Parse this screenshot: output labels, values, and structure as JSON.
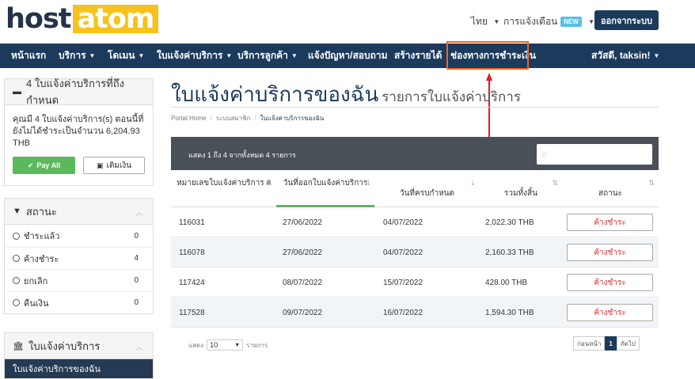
{
  "header": {
    "logo_part1": "host",
    "logo_part2": "atom",
    "language": "ไทย",
    "notifications": "การแจ้งเตือน",
    "new_badge": "NEW",
    "logout": "ออกจากระบบ"
  },
  "nav": {
    "items": [
      {
        "label": "หน้าแรก",
        "caret": false
      },
      {
        "label": "บริการ",
        "caret": true
      },
      {
        "label": "โดเมน",
        "caret": true
      },
      {
        "label": "ใบแจ้งค่าบริการ",
        "caret": true
      },
      {
        "label": "บริการลูกค้า",
        "caret": true
      },
      {
        "label": "แจ้งปัญหา/สอบถาม",
        "caret": false
      },
      {
        "label": "สร้างรายได้",
        "caret": false
      },
      {
        "label": "ช่องทางการชำระเงิน",
        "caret": false
      }
    ],
    "user": "สวัสดี, taksin!"
  },
  "sidebar": {
    "due_panel": {
      "title": "4 ใบแจ้งค่าบริการที่ถึงกำหนด",
      "text": "คุณมี 4 ใบแจ้งค่าบริการ(s) ตอนนี้ที่ยังไม่ได้ชำระเป็นจำนวน 6,204.93 THB",
      "pay_all": "Pay All",
      "add_funds": "เติมเงิน"
    },
    "status_panel": {
      "title": "สถานะ",
      "items": [
        {
          "label": "ชำระแล้ว",
          "count": "0"
        },
        {
          "label": "ค้างชำระ",
          "count": "4"
        },
        {
          "label": "ยกเลิก",
          "count": "0"
        },
        {
          "label": "คืนเงิน",
          "count": "0"
        }
      ]
    },
    "invoice_panel": {
      "title": "ใบแจ้งค่าบริการ",
      "active_item": "ใบแจ้งค่าบริการของฉัน"
    }
  },
  "main": {
    "title": "ใบแจ้งค่าบริการของฉัน",
    "subtitle": "รายการใบแจ้งค่าบริการ",
    "breadcrumb": [
      "Portal Home",
      "ระบบสมาชิก",
      "ใบแจ้งค่าบริการของฉัน"
    ],
    "table_info": "แสดง 1 ถึง 4 จากทั้งหมด 4 รายการ",
    "columns": [
      "หมายเลขใบแจ้งค่าบริการ #",
      "วันที่ออกใบแจ้งค่าบริการ",
      "วันที่ครบกำหนด",
      "รวมทั้งสิ้น",
      "สถานะ"
    ],
    "rows": [
      {
        "id": "116031",
        "issued": "27/06/2022",
        "due": "04/07/2022",
        "total": "2,022.30 THB",
        "status": "ค้างชำระ"
      },
      {
        "id": "116078",
        "issued": "27/06/2022",
        "due": "04/07/2022",
        "total": "2,160.33 THB",
        "status": "ค้างชำระ"
      },
      {
        "id": "117424",
        "issued": "08/07/2022",
        "due": "15/07/2022",
        "total": "428.00 THB",
        "status": "ค้างชำระ"
      },
      {
        "id": "117528",
        "issued": "09/07/2022",
        "due": "16/07/2022",
        "total": "1,594.30 THB",
        "status": "ค้างชำระ"
      }
    ],
    "footer": {
      "show_label": "แสดง",
      "page_size": "10",
      "items_label": "รายการ",
      "prev": "ก่อนหน้า",
      "current_page": "1",
      "next": "ถัดไป"
    }
  },
  "colors": {
    "navy": "#1b3a5c",
    "accent_yellow": "#f8c21c",
    "highlight_orange": "#f26522",
    "arrow_red": "#e8191c",
    "green": "#5cb85c",
    "unpaid_red": "#e03030"
  }
}
